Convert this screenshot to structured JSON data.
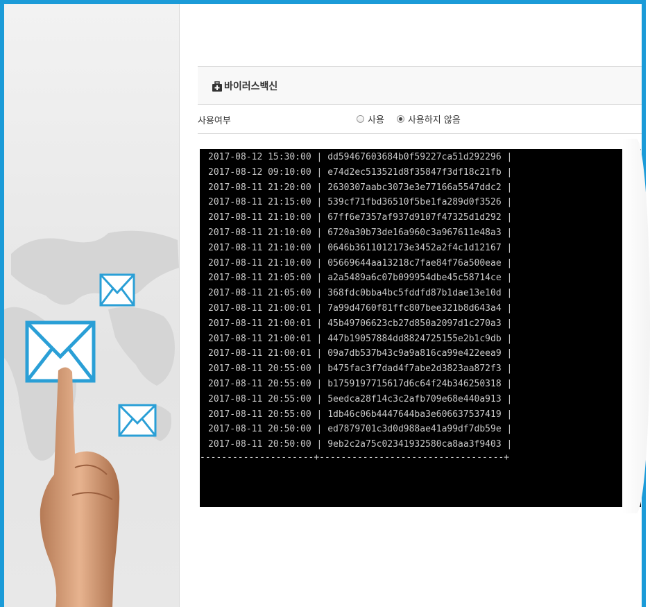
{
  "section": {
    "title": "바이러스백신",
    "icon": "first-aid-kit-icon"
  },
  "setting": {
    "label": "사용여부",
    "options": [
      {
        "label": "사용",
        "checked": false
      },
      {
        "label": "사용하지 않음",
        "checked": true
      }
    ]
  },
  "terminal": {
    "rows": [
      {
        "time": "2017-08-12 15:30:00",
        "hash": "dd59467603684b0f59227ca51d292296"
      },
      {
        "time": "2017-08-12 09:10:00",
        "hash": "e74d2ec513521d8f35847f3df18c21fb"
      },
      {
        "time": "2017-08-11 21:20:00",
        "hash": "2630307aabc3073e3e77166a5547ddc2"
      },
      {
        "time": "2017-08-11 21:15:00",
        "hash": "539cf71fbd36510f5be1fa289d0f3526"
      },
      {
        "time": "2017-08-11 21:10:00",
        "hash": "67ff6e7357af937d9107f47325d1d292"
      },
      {
        "time": "2017-08-11 21:10:00",
        "hash": "6720a30b73de16a960c3a967611e48a3"
      },
      {
        "time": "2017-08-11 21:10:00",
        "hash": "0646b3611012173e3452a2f4c1d12167"
      },
      {
        "time": "2017-08-11 21:10:00",
        "hash": "05669644aa13218c7fae84f76a500eae"
      },
      {
        "time": "2017-08-11 21:05:00",
        "hash": "a2a5489a6c07b099954dbe45c58714ce"
      },
      {
        "time": "2017-08-11 21:05:00",
        "hash": "368fdc0bba4bc5fddfd87b1dae13e10d"
      },
      {
        "time": "2017-08-11 21:00:01",
        "hash": "7a99d4760f81ffc807bee321b8d643a4"
      },
      {
        "time": "2017-08-11 21:00:01",
        "hash": "45b49706623cb27d850a2097d1c270a3"
      },
      {
        "time": "2017-08-11 21:00:01",
        "hash": "447b19057884dd8824725155e2b1c9db"
      },
      {
        "time": "2017-08-11 21:00:01",
        "hash": "09a7db537b43c9a9a816ca99e422eea9"
      },
      {
        "time": "2017-08-11 20:55:00",
        "hash": "b475fac3f7dad4f7abe2d3823aa872f3"
      },
      {
        "time": "2017-08-11 20:55:00",
        "hash": "b1759197715617d6c64f24b346250318"
      },
      {
        "time": "2017-08-11 20:55:00",
        "hash": "5eedca28f14c3c2afb709e68e440a913"
      },
      {
        "time": "2017-08-11 20:55:00",
        "hash": "1db46c06b4447644ba3e606637537419"
      },
      {
        "time": "2017-08-11 20:50:00",
        "hash": "ed7879701c3d0d988ae41a99df7db59e"
      },
      {
        "time": "2017-08-11 20:50:00",
        "hash": "9eb2c2a75c02341932580ca8aa3f9403"
      }
    ],
    "footer": "---------------------+----------------------------------+"
  },
  "colors": {
    "frame": "#1b9bd8",
    "envelope": "#2a9fd6"
  },
  "decor": {
    "icons": [
      "envelope-icon",
      "envelope-icon",
      "envelope-icon",
      "pointing-hand-icon",
      "world-map-icon"
    ]
  }
}
